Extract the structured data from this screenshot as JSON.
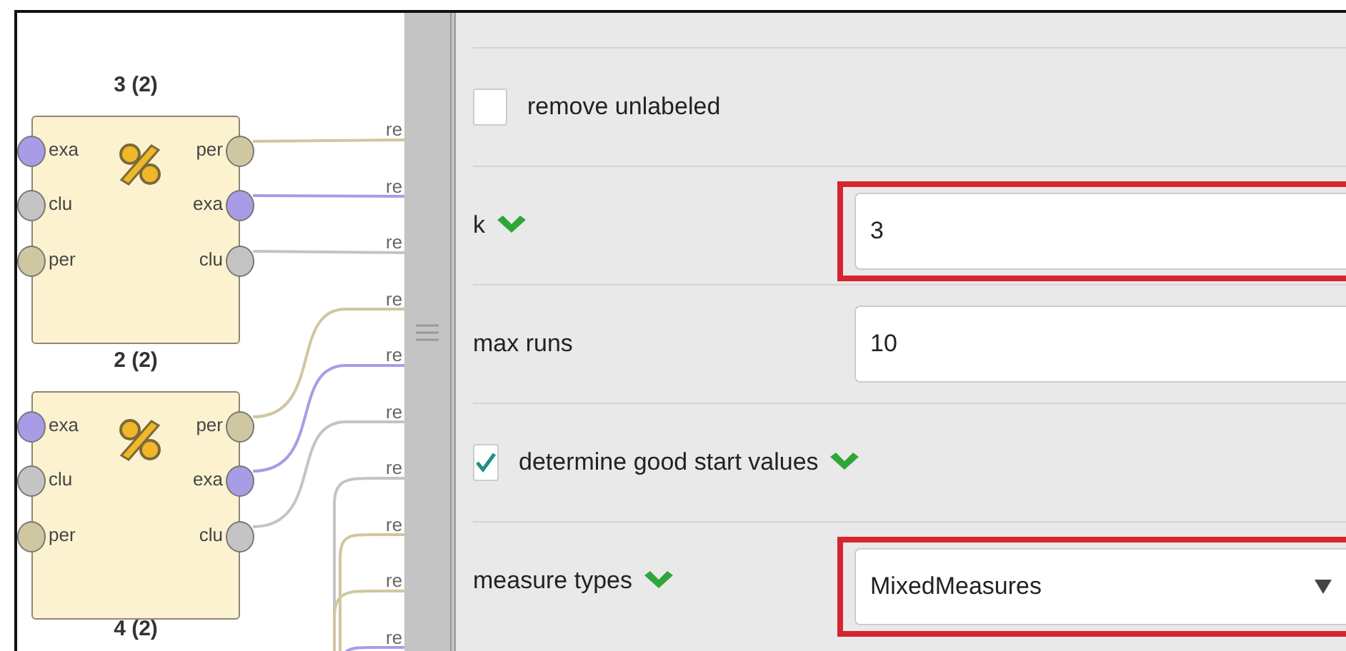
{
  "canvas": {
    "operators": [
      {
        "title": "3 (2)",
        "inputs": [
          {
            "label": "exa",
            "color": "#a99ce6"
          },
          {
            "label": "clu",
            "color": "#c4c4c4"
          },
          {
            "label": "per",
            "color": "#cfc7a0"
          }
        ],
        "outputs": [
          {
            "label": "per",
            "color": "#cfc7a0"
          },
          {
            "label": "exa",
            "color": "#a99ce6"
          },
          {
            "label": "clu",
            "color": "#c4c4c4"
          }
        ]
      },
      {
        "title": "2 (2)",
        "inputs": [
          {
            "label": "exa",
            "color": "#a99ce6"
          },
          {
            "label": "clu",
            "color": "#c4c4c4"
          },
          {
            "label": "per",
            "color": "#cfc7a0"
          }
        ],
        "outputs": [
          {
            "label": "per",
            "color": "#cfc7a0"
          },
          {
            "label": "exa",
            "color": "#a99ce6"
          },
          {
            "label": "clu",
            "color": "#c4c4c4"
          }
        ]
      },
      {
        "title": "4 (2)"
      }
    ],
    "connection_labels": [
      "re",
      "re",
      "re",
      "re",
      "re",
      "re",
      "re",
      "re",
      "re",
      "re"
    ]
  },
  "parameters": [
    {
      "kind": "checkbox",
      "label": "remove unlabeled",
      "checked": false,
      "chevron": false,
      "highlighted": false
    },
    {
      "kind": "number",
      "label": "k",
      "value": "3",
      "chevron": true,
      "highlighted": true
    },
    {
      "kind": "number",
      "label": "max runs",
      "value": "10",
      "chevron": false,
      "highlighted": false
    },
    {
      "kind": "checkbox",
      "label": "determine good start values",
      "checked": true,
      "chevron": true,
      "highlighted": false
    },
    {
      "kind": "select",
      "label": "measure types",
      "value": "MixedMeasures",
      "chevron": true,
      "highlighted": true
    }
  ]
}
